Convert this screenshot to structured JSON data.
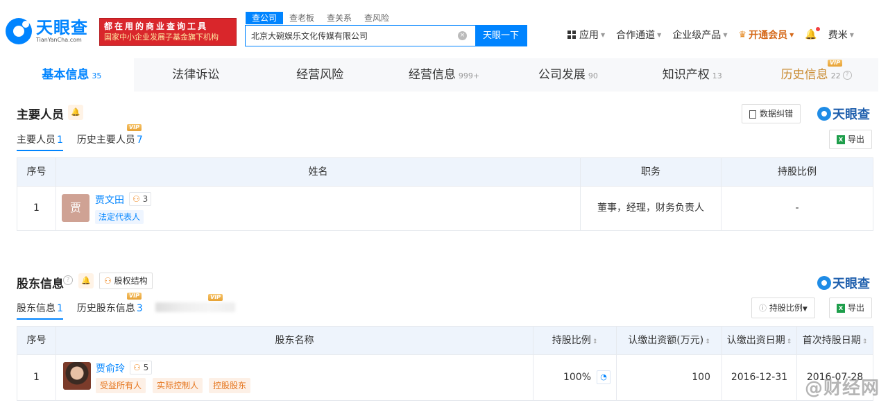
{
  "header": {
    "logo_cn": "天眼查",
    "logo_en": "TianYanCha.com",
    "ad_line1": "都在用的商业查询工具",
    "ad_line2": "国家中小企业发展子基金旗下机构",
    "search_tabs": [
      "查公司",
      "查老板",
      "查关系",
      "查风险"
    ],
    "search_value": "北京大碗娱乐文化传媒有限公司",
    "clear_icon": "×",
    "search_button": "天眼一下",
    "nav": {
      "apps": "应用",
      "channel": "合作通道",
      "enterprise": "企业级产品",
      "vip": "开通会员",
      "user": "费米"
    }
  },
  "tabs": [
    {
      "label": "基本信息",
      "count": "35"
    },
    {
      "label": "法律诉讼",
      "count": ""
    },
    {
      "label": "经营风险",
      "count": ""
    },
    {
      "label": "经营信息",
      "count": "999+"
    },
    {
      "label": "公司发展",
      "count": "90"
    },
    {
      "label": "知识产权",
      "count": "13"
    },
    {
      "label": "历史信息",
      "count": "22"
    }
  ],
  "vip_label": "VIP",
  "help_glyph": "?",
  "personnel": {
    "title": "主要人员",
    "correction_button": "数据纠错",
    "brand": "天眼查",
    "subtabs": [
      {
        "label": "主要人员",
        "count": "1"
      },
      {
        "label": "历史主要人员",
        "count": "7"
      }
    ],
    "export_button": "导出",
    "excel_glyph": "X",
    "columns": [
      "序号",
      "姓名",
      "职务",
      "持股比例"
    ],
    "rows": [
      {
        "index": "1",
        "avatar_char": "贾",
        "name": "贾文田",
        "relation_count": "3",
        "tag": "法定代表人",
        "position": "董事，经理，财务负责人",
        "share": "-"
      }
    ]
  },
  "shareholders": {
    "title": "股东信息",
    "structure_button": "股权结构",
    "brand": "天眼查",
    "subtabs": [
      {
        "label": "股东信息",
        "count": "1"
      },
      {
        "label": "历史股东信息",
        "count": "3"
      }
    ],
    "ratio_filter": "持股比例",
    "export_button": "导出",
    "columns": [
      "序号",
      "股东名称",
      "持股比例",
      "认缴出资额(万元)",
      "认缴出资日期",
      "首次持股日期"
    ],
    "rows": [
      {
        "index": "1",
        "name": "贾俞玲",
        "relation_count": "5",
        "tags": [
          "受益所有人",
          "实际控制人",
          "控股股东"
        ],
        "share": "100%",
        "amount": "100",
        "subscribe_date": "2016-12-31",
        "first_date": "2016-07-28"
      }
    ]
  },
  "watermark": "@财经网"
}
